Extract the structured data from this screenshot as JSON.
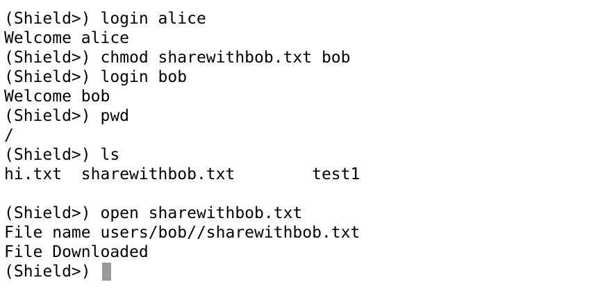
{
  "terminal": {
    "lines": [
      "(Shield>) login alice",
      "Welcome alice",
      "(Shield>) chmod sharewithbob.txt bob",
      "(Shield>) login bob",
      "Welcome bob",
      "(Shield>) pwd",
      "/",
      "(Shield>) ls",
      "hi.txt  sharewithbob.txt        test1",
      "",
      "(Shield>) open sharewithbob.txt",
      "File name users/bob//sharewithbob.txt",
      "File Downloaded"
    ],
    "prompt": "(Shield>) ",
    "cursor_color": "#999999"
  }
}
